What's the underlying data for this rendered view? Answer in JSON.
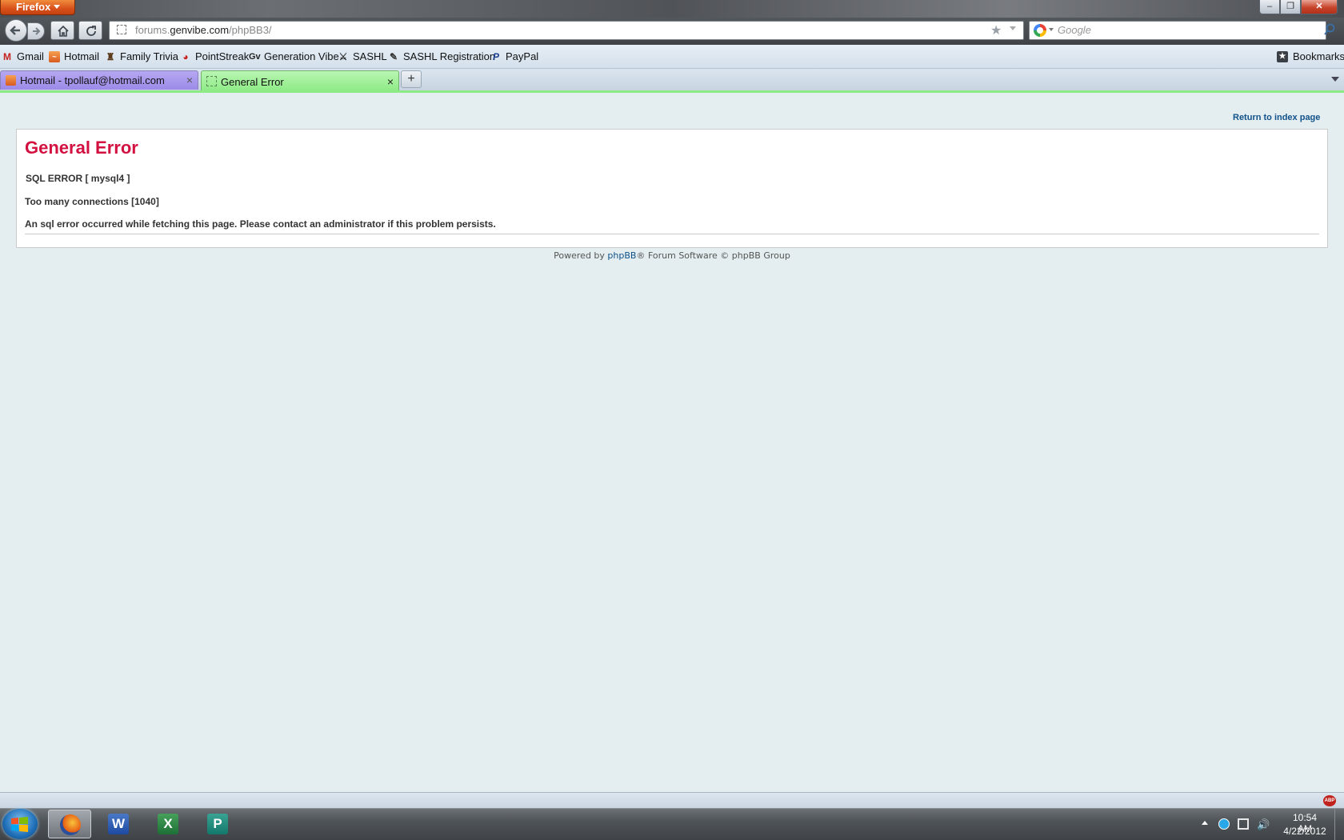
{
  "browser": {
    "app_button": "Firefox",
    "window_controls": {
      "minimize": "–",
      "maximize": "❐",
      "close": "✕"
    },
    "url_host_pre": "forums.",
    "url_host_main": "genvibe.com",
    "url_path": "/phpBB3/",
    "search_placeholder": "Google"
  },
  "bookmarks": {
    "items": [
      {
        "label": "Gmail",
        "icon": "gmail-icon"
      },
      {
        "label": "Hotmail",
        "icon": "hotmail-icon"
      },
      {
        "label": "Family Trivia",
        "icon": "family-trivia-icon"
      },
      {
        "label": "PointStreak",
        "icon": "pointstreak-icon"
      },
      {
        "label": "Generation Vibe",
        "icon": "generation-vibe-icon"
      },
      {
        "label": "SASHL",
        "icon": "sashl-icon"
      },
      {
        "label": "SASHL Registration",
        "icon": "sashl-registration-icon"
      },
      {
        "label": "PayPal",
        "icon": "paypal-icon"
      }
    ],
    "menu_label": "Bookmarks"
  },
  "tabs": [
    {
      "label": "Hotmail - tpollauf@hotmail.com",
      "active": false,
      "color": "#9c8be8"
    },
    {
      "label": "General Error",
      "active": true,
      "color": "#8deb85"
    }
  ],
  "page": {
    "return_link": "Return to index page",
    "title": "General Error",
    "line1": "SQL ERROR [ mysql4 ]",
    "line2": "Too many connections [1040]",
    "line3": "An sql error occurred while fetching this page. Please contact an administrator if this problem persists.",
    "footer_prefix": "Powered by ",
    "footer_link": "phpBB",
    "footer_suffix": "® Forum Software © phpBB Group",
    "title_color": "#d31141",
    "link_color": "#105289"
  },
  "addon_bar": {
    "abp_label": "ABP"
  },
  "taskbar": {
    "apps": [
      "firefox-icon",
      "word-icon",
      "excel-icon",
      "publisher-icon"
    ],
    "word_letter": "W",
    "excel_letter": "X",
    "publisher_letter": "P",
    "clock_time": "10:54 AM",
    "clock_date": "4/22/2012"
  }
}
